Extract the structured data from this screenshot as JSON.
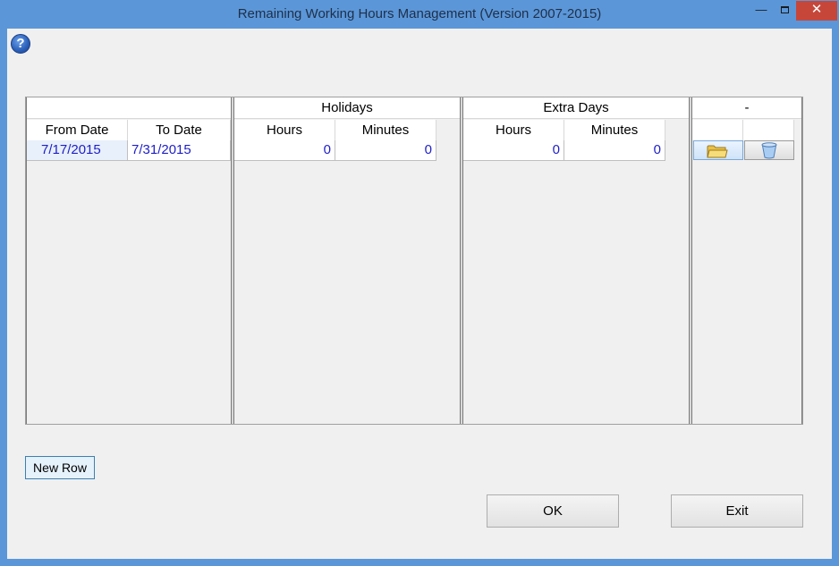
{
  "window": {
    "title": "Remaining Working Hours Management (Version 2007-2015)",
    "minimize_glyph": "—",
    "close_glyph": "✕"
  },
  "help": {
    "glyph": "?"
  },
  "grid": {
    "date_group": {
      "columns": [
        "From Date",
        "To Date"
      ]
    },
    "holidays": {
      "title": "Holidays",
      "columns": [
        "Hours",
        "Minutes"
      ]
    },
    "extra_days": {
      "title": "Extra Days",
      "columns": [
        "Hours",
        "Minutes"
      ]
    },
    "actions": {
      "title": "-"
    },
    "rows": [
      {
        "from_date": "7/17/2015",
        "to_date": "7/31/2015",
        "holiday_hours": "0",
        "holiday_minutes": "0",
        "extra_hours": "0",
        "extra_minutes": "0",
        "open_icon": "folder-icon",
        "delete_icon": "recycle-bin-icon"
      }
    ]
  },
  "buttons": {
    "new_row": "New Row",
    "ok": "OK",
    "exit": "Exit"
  },
  "colors": {
    "title_bar": "#5b97d8",
    "close_button": "#c7463a",
    "cell_text": "#1e1ec8"
  }
}
